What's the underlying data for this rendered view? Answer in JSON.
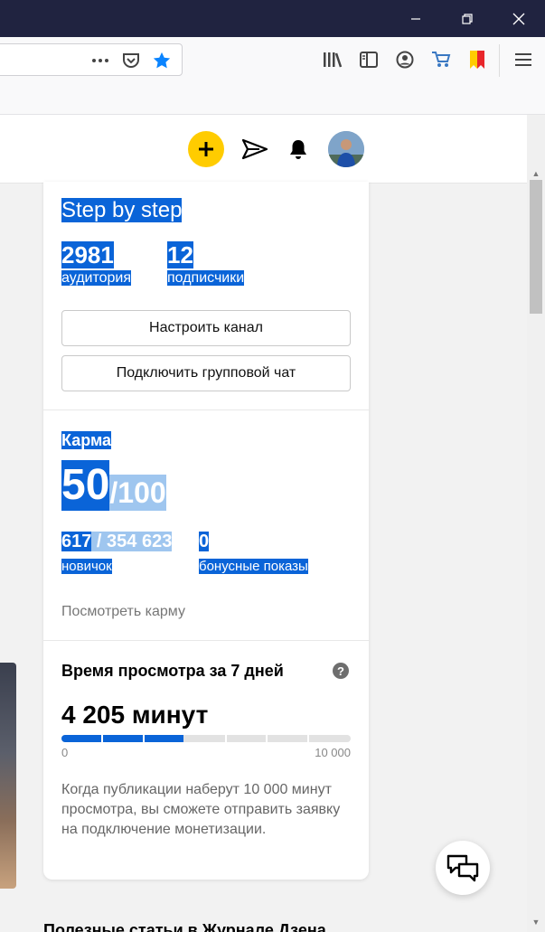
{
  "browser": {
    "window_controls": {
      "minimize_icon": "minimize-icon",
      "restore_icon": "restore-icon",
      "close_icon": "close-icon"
    },
    "toolbar_icons": [
      "more-dots-icon",
      "pocket-icon",
      "bookmark-star-icon",
      "library-icon",
      "sidebar-icon",
      "account-icon",
      "cart-icon",
      "bookmark-flag-icon",
      "menu-icon"
    ]
  },
  "site_header": {
    "icons": [
      "plus-icon",
      "paper-plane-icon",
      "bell-icon",
      "avatar"
    ]
  },
  "channel": {
    "name": "Step by step",
    "audience_value": "2981",
    "audience_label": "аудитория",
    "subscribers_value": "12",
    "subscribers_label": "подписчики",
    "setup_button": "Настроить канал",
    "group_chat_button": "Подключить групповой чат"
  },
  "karma": {
    "title": "Карма",
    "value": "50",
    "max": "/100",
    "rank_value": "617",
    "rank_total": " / 354 623",
    "rank_label": "новичок",
    "bonus_value": "0",
    "bonus_label": "бонусные показы",
    "link": "Посмотреть карму"
  },
  "watch_time": {
    "title": "Время просмотра за 7 дней",
    "help": "?",
    "value_text": "4 205 минут",
    "progress_value": 4205,
    "progress_max": 10000,
    "scale_min": "0",
    "scale_max": "10 000",
    "note": "Когда публикации наберут 10 000 минут просмотра, вы сможете отправить заявку на подключение монетизации."
  },
  "bottom": {
    "partial_heading": "Полезные статьи в Журнале Дзена"
  },
  "colors": {
    "titlebar": "#202340",
    "accent_yellow": "#ffcc00",
    "selection": "#0a64d8",
    "progress": "#0a64d8"
  }
}
